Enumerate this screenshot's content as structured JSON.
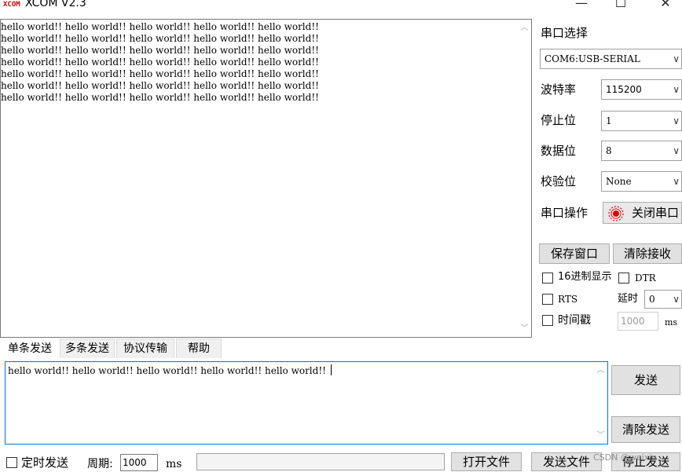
{
  "window": {
    "logo_text": "XCOM",
    "title": "XCOM V2.3",
    "minimize_glyph": "—",
    "maximize_glyph": "☐",
    "close_glyph": "✕"
  },
  "receive": {
    "lines": [
      "hello world!! hello world!! hello world!! hello world!! hello world!!",
      "hello world!! hello world!! hello world!! hello world!! hello world!!",
      "hello world!! hello world!! hello world!! hello world!! hello world!!",
      "hello world!! hello world!! hello world!! hello world!! hello world!!",
      "hello world!! hello world!! hello world!! hello world!! hello world!!",
      "hello world!! hello world!! hello world!! hello world!! hello world!!",
      "hello world!! hello world!! hello world!! hello world!! hello world!!"
    ]
  },
  "serial": {
    "port_select_label": "串口选择",
    "port_value": "COM6:USB-SERIAL",
    "baud_label": "波特率",
    "baud_value": "115200",
    "stop_label": "停止位",
    "stop_value": "1",
    "data_label": "数据位",
    "data_value": "8",
    "parity_label": "校验位",
    "parity_value": "None",
    "op_label": "串口操作",
    "op_button": "关闭串口",
    "op_indicator_color": "#e00000"
  },
  "actions": {
    "save_window": "保存窗口",
    "clear_receive": "清除接收"
  },
  "options": {
    "hex_display": "16进制显示",
    "dtr": "DTR",
    "rts": "RTS",
    "delay_label": "延时",
    "delay_value": "0",
    "timestamp": "时间戳",
    "timestamp_interval": "1000",
    "timestamp_unit": "ms"
  },
  "tabs": [
    "单条发送",
    "多条发送",
    "协议传输",
    "帮助"
  ],
  "send": {
    "text": "hello world!! hello world!! hello world!! hello world!! hello world!! ",
    "send_button": "发送",
    "clear_send_button": "清除发送"
  },
  "bottom": {
    "timed_send": "定时发送",
    "period_label": "周期:",
    "period_value": "1000",
    "period_unit": "ms",
    "open_file": "打开文件",
    "send_file": "发送文件",
    "stop_send": "停止发送",
    "watermark": "CSDN @weixin"
  }
}
